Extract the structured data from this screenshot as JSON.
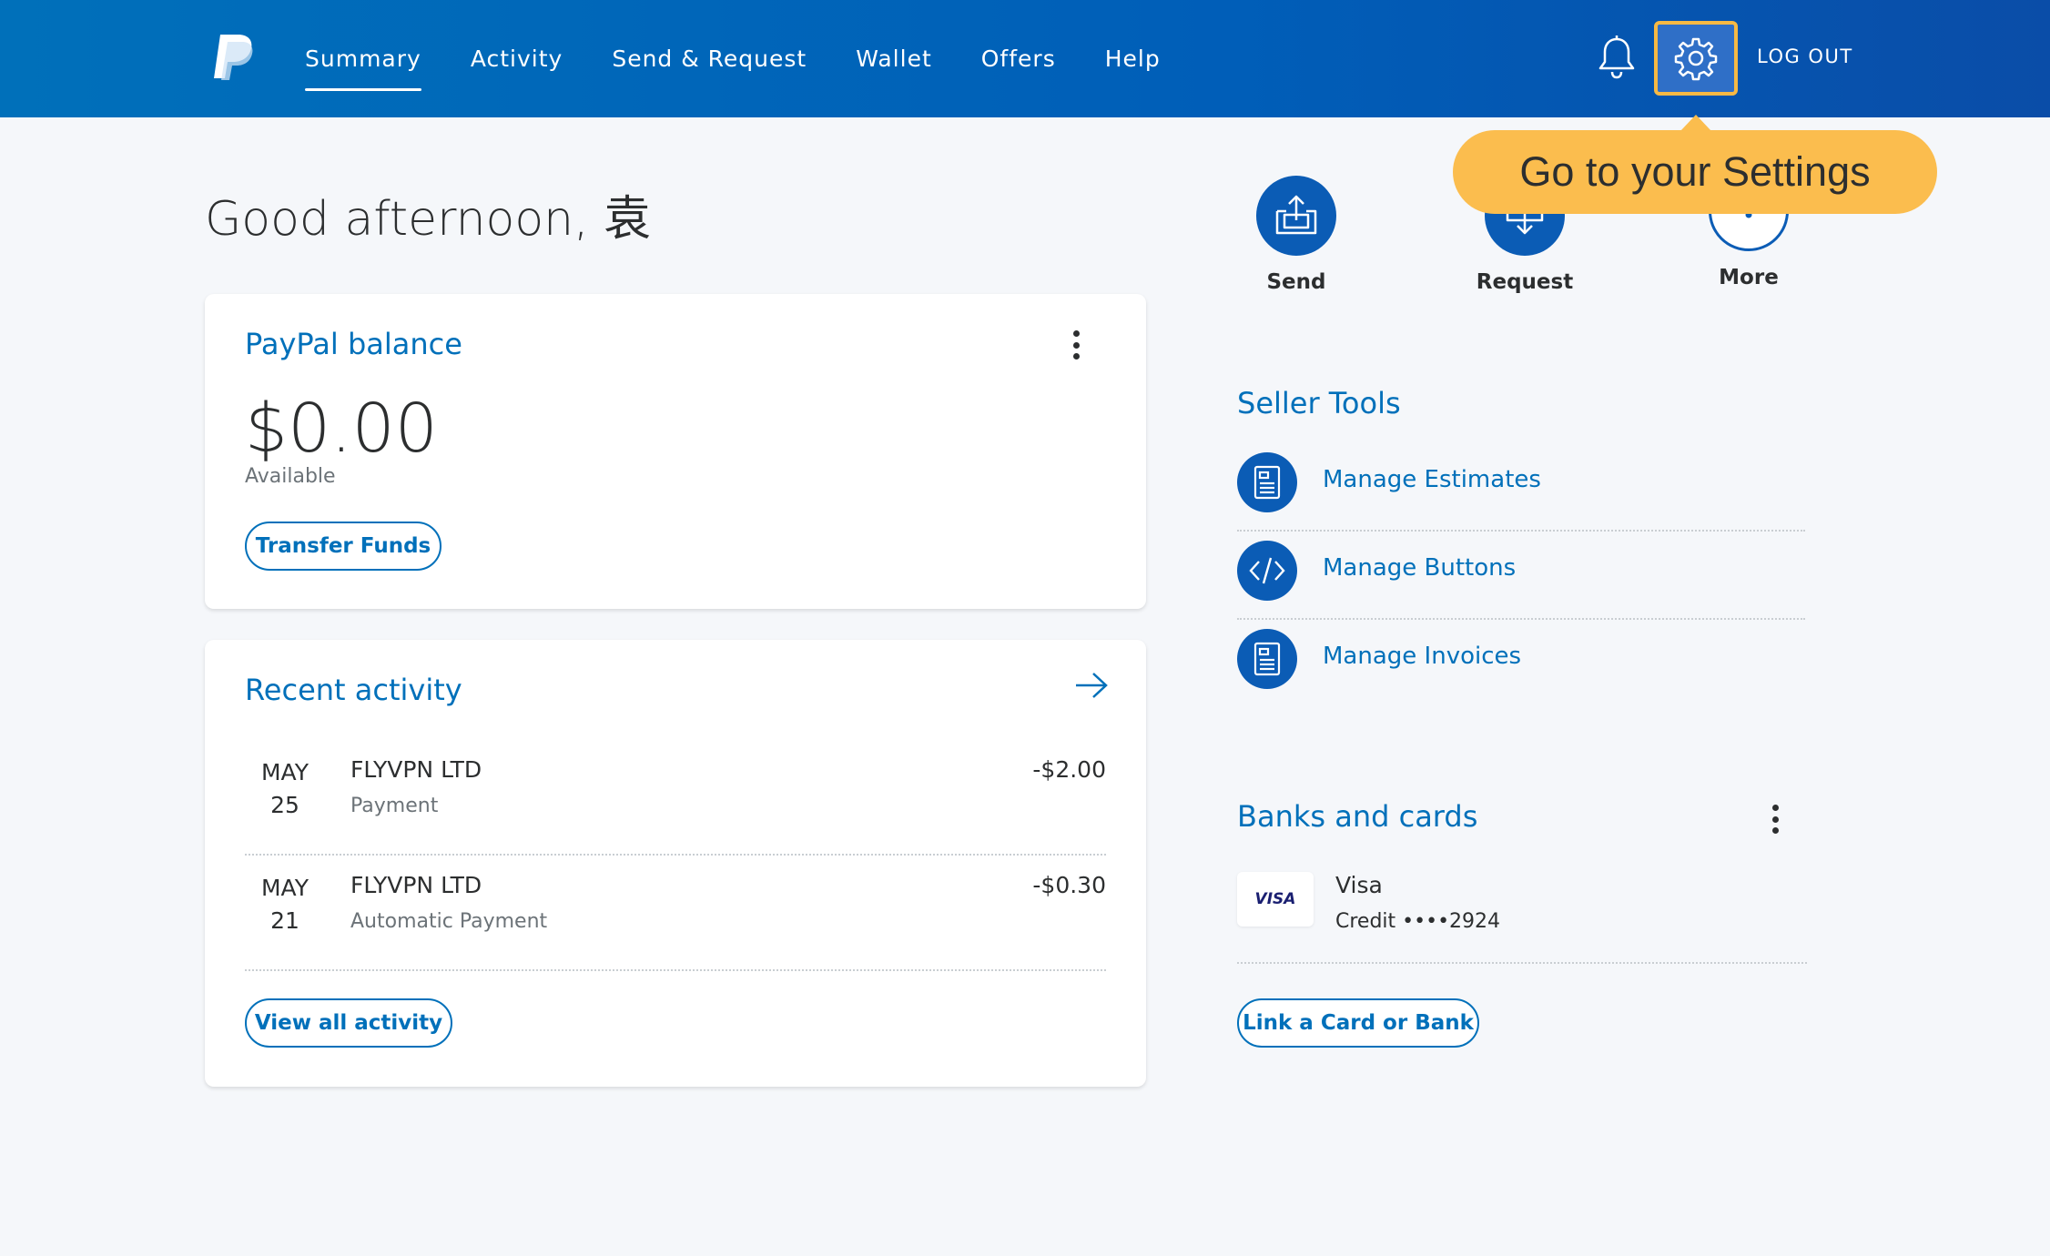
{
  "header": {
    "nav": [
      "Summary",
      "Activity",
      "Send & Request",
      "Wallet",
      "Offers",
      "Help"
    ],
    "active_nav": "Summary",
    "logout_label": "LOG OUT"
  },
  "tooltip": {
    "text": "Go to your Settings"
  },
  "greeting": "Good afternoon, 袁",
  "balance": {
    "title": "PayPal balance",
    "amount": "$0.00",
    "sub": "Available",
    "transfer_label": "Transfer Funds"
  },
  "activity": {
    "title": "Recent activity",
    "items": [
      {
        "month": "MAY",
        "day": "25",
        "name": "FLYVPN LTD",
        "type": "Payment",
        "amount": "-$2.00"
      },
      {
        "month": "MAY",
        "day": "21",
        "name": "FLYVPN LTD",
        "type": "Automatic Payment",
        "amount": "-$0.30"
      }
    ],
    "view_all_label": "View all activity"
  },
  "quick_actions": [
    {
      "label": "Send",
      "icon": "send-money-icon"
    },
    {
      "label": "Request",
      "icon": "request-money-icon"
    },
    {
      "label": "More",
      "icon": "more-icon"
    }
  ],
  "seller_tools": {
    "title": "Seller Tools",
    "items": [
      {
        "label": "Manage Estimates",
        "icon": "document-icon"
      },
      {
        "label": "Manage Buttons",
        "icon": "code-icon"
      },
      {
        "label": "Manage Invoices",
        "icon": "document-icon"
      }
    ]
  },
  "banks": {
    "title": "Banks and cards",
    "card_logo": "VISA",
    "card_name": "Visa",
    "card_sub": "Credit ••••2924",
    "link_label": "Link a Card or Bank"
  },
  "colors": {
    "primary": "#0070ba",
    "header": "#005eb8",
    "tooltip": "#fbbd4e"
  }
}
